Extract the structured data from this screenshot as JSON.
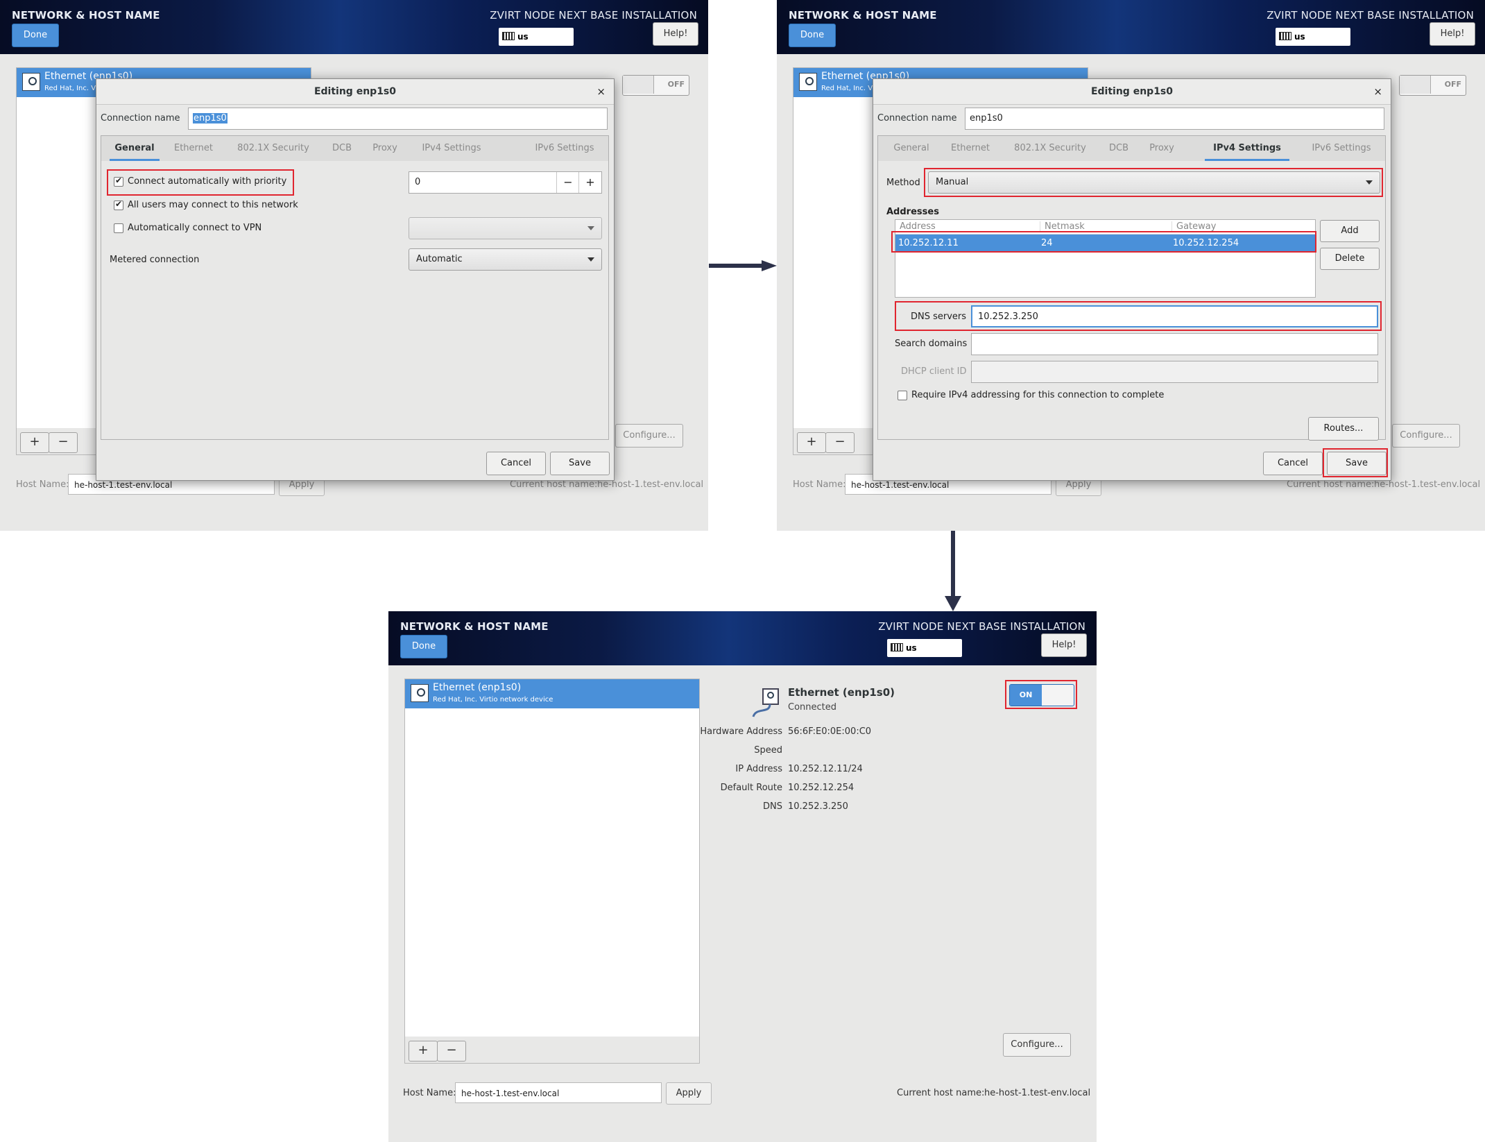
{
  "common": {
    "title": "NETWORK & HOST NAME",
    "subtitle": "ZVIRT NODE NEXT BASE INSTALLATION",
    "done": "Done",
    "help": "Help!",
    "keyboard": "us",
    "device_name": "Ethernet (enp1s0)",
    "device_desc_short": "Red Hat, Inc. V",
    "device_desc": "Red Hat, Inc. Virtio network device",
    "add": "+",
    "remove": "−",
    "configure": "Configure...",
    "host_label": "Host Name:",
    "host_value": "he-host-1.test-env.local",
    "apply": "Apply",
    "current_label": "Current host name:",
    "current_value": "he-host-1.test-env.local",
    "toggle_off": "OFF",
    "toggle_on": "ON"
  },
  "dialog": {
    "title": "Editing enp1s0",
    "close": "×",
    "conn_label": "Connection name",
    "conn_value": "enp1s0",
    "tabs": [
      "General",
      "Ethernet",
      "802.1X Security",
      "DCB",
      "Proxy",
      "IPv4 Settings",
      "IPv6 Settings"
    ],
    "cancel": "Cancel",
    "save": "Save"
  },
  "general": {
    "auto_connect": "Connect automatically with priority",
    "priority": "0",
    "minus": "−",
    "plus": "+",
    "all_users": "All users may connect to this network",
    "auto_vpn": "Automatically connect to VPN",
    "metered_label": "Metered connection",
    "metered_value": "Automatic"
  },
  "ipv4": {
    "method_label": "Method",
    "method_value": "Manual",
    "addresses_label": "Addresses",
    "col_address": "Address",
    "col_netmask": "Netmask",
    "col_gateway": "Gateway",
    "row_address": "10.252.12.11",
    "row_netmask": "24",
    "row_gateway": "10.252.12.254",
    "add": "Add",
    "delete": "Delete",
    "dns_label": "DNS servers",
    "dns_value": "10.252.3.250",
    "search_label": "Search domains",
    "dhcp_label": "DHCP client ID",
    "require": "Require IPv4 addressing for this connection to complete",
    "routes": "Routes..."
  },
  "details": {
    "name": "Ethernet (enp1s0)",
    "status": "Connected",
    "hw_label": "Hardware Address",
    "hw_value": "56:6F:E0:0E:00:C0",
    "speed_label": "Speed",
    "ip_label": "IP Address",
    "ip_value": "10.252.12.11/24",
    "route_label": "Default Route",
    "route_value": "10.252.12.254",
    "dns_label": "DNS",
    "dns_value": "10.252.3.250"
  },
  "colors": {
    "accent": "#4a90d9",
    "highlight": "#e0252f",
    "header_dark": "#060c24"
  }
}
